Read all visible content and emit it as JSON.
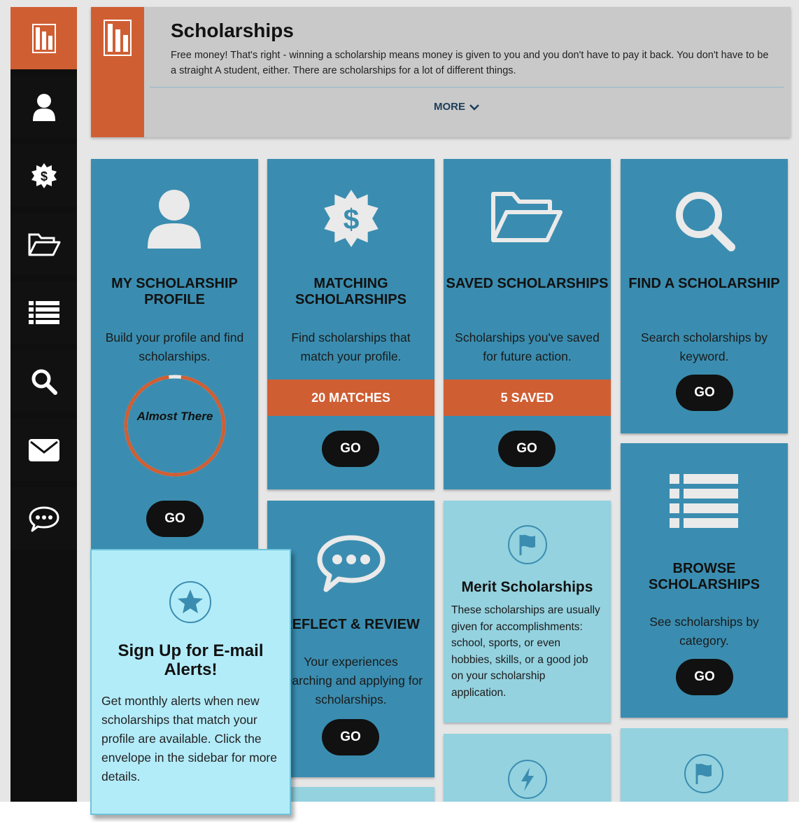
{
  "header": {
    "title": "Scholarships",
    "description": "Free money! That's right - winning a scholarship means money is given to you and you don't have to pay it back. You don't have to be a straight A student, either. There are scholarships for a lot of different things.",
    "more_label": "MORE"
  },
  "sidebar": {
    "items": [
      {
        "icon": "scholarships-icon"
      },
      {
        "icon": "user-icon"
      },
      {
        "icon": "dollar-badge-icon"
      },
      {
        "icon": "folder-icon"
      },
      {
        "icon": "list-icon"
      },
      {
        "icon": "search-icon"
      },
      {
        "icon": "envelope-icon"
      },
      {
        "icon": "chat-icon"
      }
    ],
    "active_color": "#d05e33"
  },
  "tiles": {
    "profile": {
      "title": "MY SCHOLARSHIP PROFILE",
      "desc": "Build your profile and find scholarships.",
      "progress_label": "Almost There",
      "progress_fraction": 0.96,
      "go": "GO"
    },
    "matching": {
      "title": "MATCHING SCHOLARSHIPS",
      "desc": "Find scholarships that match your profile.",
      "count": "20 MATCHES",
      "go": "GO"
    },
    "saved": {
      "title": "SAVED SCHOLARSHIPS",
      "desc": "Scholarships you've saved for future action.",
      "count": "5 SAVED",
      "go": "GO"
    },
    "find": {
      "title": "FIND A SCHOLARSHIP",
      "desc": "Search scholarships by keyword.",
      "go": "GO"
    },
    "reflect": {
      "title": "REFLECT & REVIEW",
      "desc": "Your experiences searching and applying for scholarships.",
      "go": "GO"
    },
    "merit": {
      "title": "Merit Scholarships",
      "desc": "These scholarships are usually given for accomplishments: school, sports, or even hobbies, skills, or a good job on your scholarship application."
    },
    "browse": {
      "title": "BROWSE SCHOLARSHIPS",
      "desc": "See scholarships by category.",
      "go": "GO"
    }
  },
  "popup": {
    "title": "Sign Up for E-mail Alerts!",
    "desc": "Get monthly alerts when new scholarships that match your profile are available. Click the envelope in the sidebar for more details."
  },
  "colors": {
    "tile": "#3a8db0",
    "tile_light": "#94d2df",
    "accent": "#d05e33",
    "popup": "#b3ecf9"
  }
}
